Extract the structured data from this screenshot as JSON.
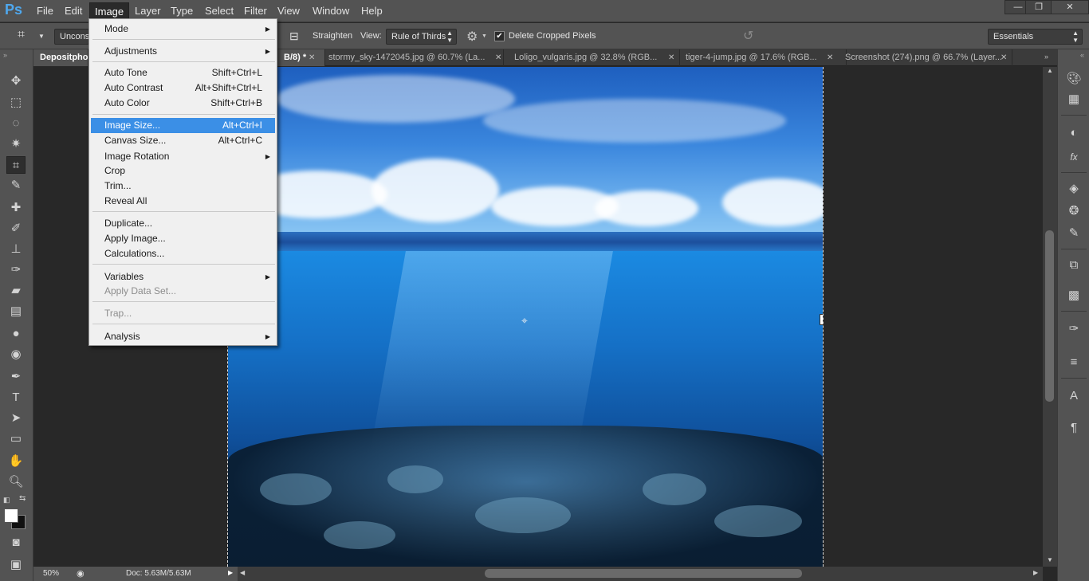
{
  "app": {
    "logo": "Ps"
  },
  "menubar": [
    "File",
    "Edit",
    "Image",
    "Layer",
    "Type",
    "Select",
    "Filter",
    "View",
    "Window",
    "Help"
  ],
  "window_controls": {
    "minimize": "—",
    "restore": "❐",
    "close": "✕"
  },
  "options": {
    "constrain_label": "Unconst",
    "straighten_label": "Straighten",
    "view_label": "View:",
    "view_value": "Rule of Thirds",
    "delete_cropped_label": "Delete Cropped Pixels",
    "delete_cropped_checked": true,
    "workspace": "Essentials"
  },
  "tabs": [
    {
      "label": "Depositpho",
      "active": true
    },
    {
      "label": "B/8) *",
      "active": true
    },
    {
      "label": "stormy_sky-1472045.jpg @ 60.7% (La...",
      "active": false
    },
    {
      "label": "Loligo_vulgaris.jpg @ 32.8% (RGB...",
      "active": false
    },
    {
      "label": "tiger-4-jump.jpg @ 17.6% (RGB...",
      "active": false
    },
    {
      "label": "Screenshot (274).png @ 66.7% (Layer...",
      "active": false
    }
  ],
  "image_menu": {
    "items": [
      {
        "label": "Mode",
        "shortcut": "",
        "submenu": true
      },
      {
        "label": "Adjustments",
        "shortcut": "",
        "submenu": true
      },
      {
        "label": "Auto Tone",
        "shortcut": "Shift+Ctrl+L"
      },
      {
        "label": "Auto Contrast",
        "shortcut": "Alt+Shift+Ctrl+L"
      },
      {
        "label": "Auto Color",
        "shortcut": "Shift+Ctrl+B"
      },
      {
        "label": "Image Size...",
        "shortcut": "Alt+Ctrl+I",
        "highlighted": true
      },
      {
        "label": "Canvas Size...",
        "shortcut": "Alt+Ctrl+C"
      },
      {
        "label": "Image Rotation",
        "shortcut": "",
        "submenu": true
      },
      {
        "label": "Crop",
        "shortcut": ""
      },
      {
        "label": "Trim...",
        "shortcut": ""
      },
      {
        "label": "Reveal All",
        "shortcut": ""
      },
      {
        "label": "Duplicate...",
        "shortcut": ""
      },
      {
        "label": "Apply Image...",
        "shortcut": ""
      },
      {
        "label": "Calculations...",
        "shortcut": ""
      },
      {
        "label": "Variables",
        "shortcut": "",
        "submenu": true
      },
      {
        "label": "Apply Data Set...",
        "shortcut": "",
        "disabled": true
      },
      {
        "label": "Trap...",
        "shortcut": "",
        "disabled": true
      },
      {
        "label": "Analysis",
        "shortcut": "",
        "submenu": true
      }
    ]
  },
  "status": {
    "zoom": "50%",
    "doc": "Doc: 5.63M/5.63M"
  },
  "colors": {
    "accent": "#3b8fe6",
    "ps_blue": "#4fa8ee",
    "chrome": "#535353",
    "canvas_bg": "#282828"
  }
}
